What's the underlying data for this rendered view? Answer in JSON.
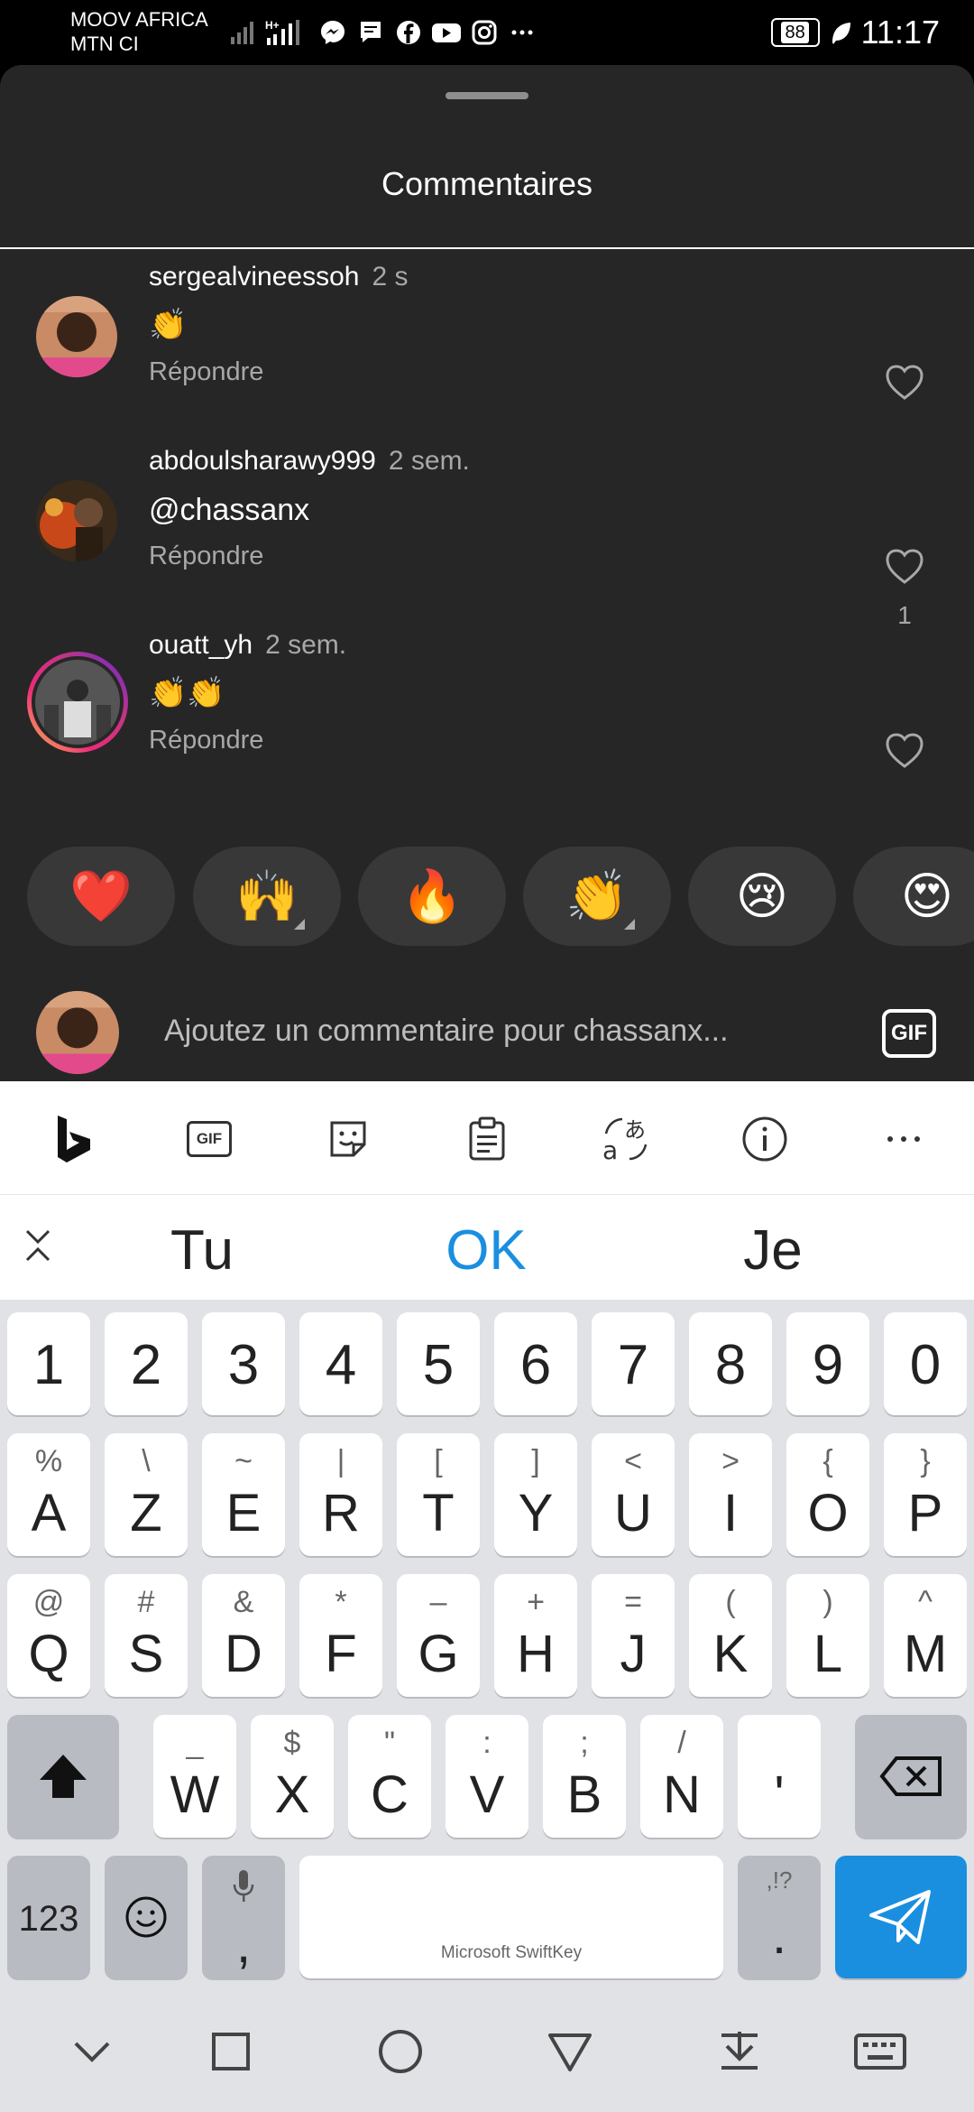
{
  "status_bar": {
    "carrier_line1": "MOOV AFRICA",
    "carrier_line2": "MTN CI",
    "network": "H+",
    "battery": "88",
    "time": "11:17",
    "icons": [
      "signal-icon",
      "signal-h-plus-icon",
      "messenger-icon",
      "message-icon",
      "facebook-icon",
      "youtube-icon",
      "instagram-icon",
      "more-notifications-icon",
      "battery-icon",
      "eco-leaf-icon"
    ]
  },
  "sheet": {
    "title": "Commentaires"
  },
  "comments": [
    {
      "username": "sergealvineessoh",
      "time": "2 s",
      "text": "👏",
      "reply": "Répondre",
      "likes": ""
    },
    {
      "username": "abdoulsharawy999",
      "time": "2 sem.",
      "text": "@chassanx",
      "reply": "Répondre",
      "likes": "1"
    },
    {
      "username": "ouatt_yh",
      "time": "2 sem.",
      "text": "👏👏",
      "reply": "Répondre",
      "likes": ""
    }
  ],
  "reactions": [
    "❤️",
    "🙌",
    "🔥",
    "👏",
    "😢",
    "😍"
  ],
  "input": {
    "placeholder": "Ajoutez un commentaire pour chassanx...",
    "gif_label": "GIF"
  },
  "keyboard": {
    "toolbar_gif": "GIF",
    "suggestions": [
      "Tu",
      "OK",
      "Je"
    ],
    "number_row": [
      "1",
      "2",
      "3",
      "4",
      "5",
      "6",
      "7",
      "8",
      "9",
      "0"
    ],
    "row1": [
      {
        "main": "A",
        "alt": "%"
      },
      {
        "main": "Z",
        "alt": "\\"
      },
      {
        "main": "E",
        "alt": "~"
      },
      {
        "main": "R",
        "alt": "|"
      },
      {
        "main": "T",
        "alt": "["
      },
      {
        "main": "Y",
        "alt": "]"
      },
      {
        "main": "U",
        "alt": "<"
      },
      {
        "main": "I",
        "alt": ">"
      },
      {
        "main": "O",
        "alt": "{"
      },
      {
        "main": "P",
        "alt": "}"
      }
    ],
    "row2": [
      {
        "main": "Q",
        "alt": "@"
      },
      {
        "main": "S",
        "alt": "#"
      },
      {
        "main": "D",
        "alt": "&"
      },
      {
        "main": "F",
        "alt": "*"
      },
      {
        "main": "G",
        "alt": "–"
      },
      {
        "main": "H",
        "alt": "+"
      },
      {
        "main": "J",
        "alt": "="
      },
      {
        "main": "K",
        "alt": "("
      },
      {
        "main": "L",
        "alt": ")"
      },
      {
        "main": "M",
        "alt": "^"
      }
    ],
    "row3": [
      {
        "main": "W",
        "alt": "_"
      },
      {
        "main": "X",
        "alt": "$"
      },
      {
        "main": "C",
        "alt": "\""
      },
      {
        "main": "V",
        "alt": ":"
      },
      {
        "main": "B",
        "alt": ";"
      },
      {
        "main": "N",
        "alt": "/"
      },
      {
        "main": "'",
        "alt": ""
      }
    ],
    "bottom": {
      "numbers_label": "123",
      "comma": ",",
      "space_label": "Microsoft SwiftKey",
      "period": ".",
      "period_alt": ",!?"
    }
  }
}
